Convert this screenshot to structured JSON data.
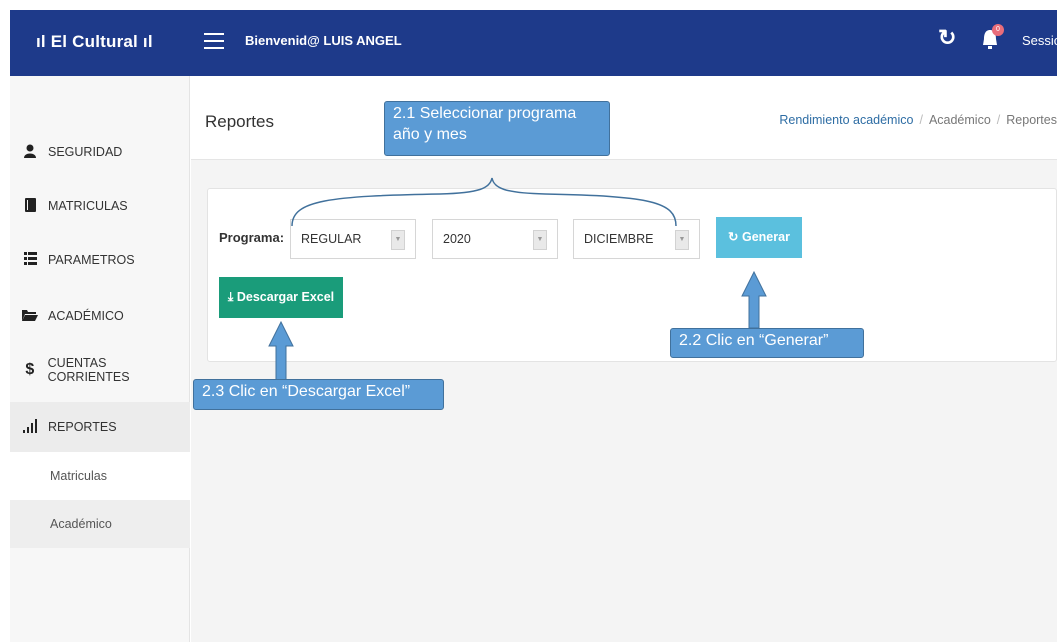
{
  "topbar": {
    "brand": "ıl El Cultural ıl",
    "welcome": "Bienvenid@ LUIS ANGEL",
    "notification_count": "0",
    "session_label": "Session ⌄"
  },
  "sidebar": {
    "items": [
      {
        "icon": "user-icon",
        "label": "SEGURIDAD"
      },
      {
        "icon": "book-icon",
        "label": "MATRICULAS"
      },
      {
        "icon": "list-icon",
        "label": "PARAMETROS"
      },
      {
        "icon": "folder-icon",
        "label": "ACADÉMICO"
      },
      {
        "icon": "dollar-icon",
        "label": "CUENTAS CORRIENTES"
      },
      {
        "icon": "bar-chart-icon",
        "label": "REPORTES"
      }
    ],
    "sub_items": [
      {
        "label": "Matriculas"
      },
      {
        "label": "Académico"
      }
    ]
  },
  "page": {
    "title": "Reportes",
    "breadcrumb": [
      "Rendimiento académico",
      "Académico",
      "Reportes"
    ]
  },
  "form": {
    "programa_label": "Programa:",
    "programa_value": "REGULAR",
    "year_value": "2020",
    "month_value": "DICIEMBRE",
    "generar_label": "Generar",
    "excel_label": "Descargar Excel"
  },
  "annotations": {
    "step1_line1": "2.1 Seleccionar programa",
    "step1_line2": "año y mes",
    "step2": "2.2 Clic en “Generar”",
    "step3": "2.3 Clic en “Descargar Excel”"
  },
  "colors": {
    "topbar": "#1e3a8a",
    "generar": "#5bc0de",
    "excel": "#1a9c7a",
    "callout": "#5b9bd5"
  }
}
